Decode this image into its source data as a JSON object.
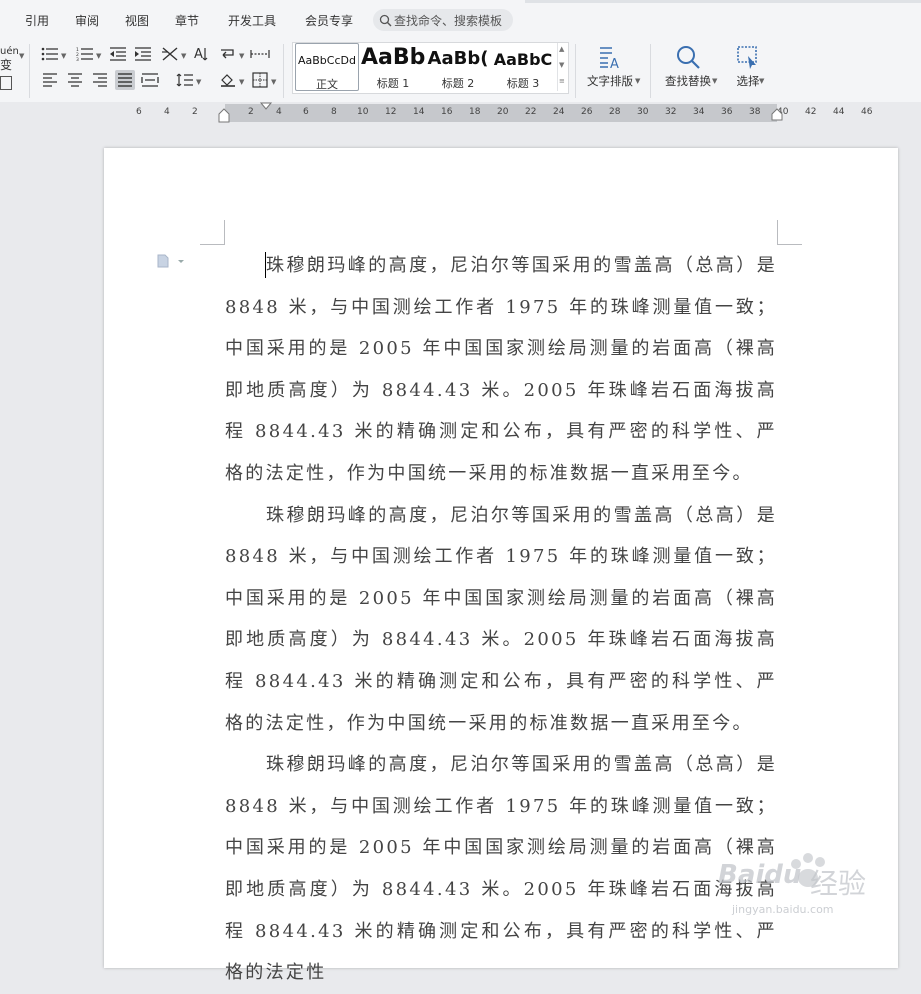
{
  "menu": {
    "items": [
      "引用",
      "审阅",
      "视图",
      "章节",
      "开发工具",
      "会员专享"
    ],
    "search_placeholder": "查找命令、搜索模板"
  },
  "ribbon": {
    "partial_left_glyphs": [
      "uén",
      "变"
    ],
    "styles": [
      {
        "sample": "AaBbCcDd",
        "name": "正文"
      },
      {
        "sample": "AaBb",
        "name": "标题 1"
      },
      {
        "sample": "AaBb(",
        "name": "标题 2"
      },
      {
        "sample": "AaBbC",
        "name": "标题 3"
      }
    ],
    "text_layout_label": "文字排版",
    "find_replace_label": "查找替换",
    "select_label": "选择"
  },
  "ruler": {
    "numbers": [
      "6",
      "4",
      "2",
      "2",
      "4",
      "6",
      "8",
      "10",
      "12",
      "14",
      "16",
      "18",
      "20",
      "22",
      "24",
      "26",
      "28",
      "30",
      "32",
      "34",
      "36",
      "38",
      "40",
      "42",
      "44",
      "46"
    ]
  },
  "document": {
    "paragraphs": [
      "珠穆朗玛峰的高度，尼泊尔等国采用的雪盖高（总高）是 8848 米，与中国测绘工作者 1975 年的珠峰测量值一致；中国采用的是 2005 年中国国家测绘局测量的岩面高（裸高即地质高度）为 8844.43 米。2005 年珠峰岩石面海拔高程 8844.43 米的精确测定和公布，具有严密的科学性、严格的法定性，作为中国统一采用的标准数据一直采用至今。",
      "珠穆朗玛峰的高度，尼泊尔等国采用的雪盖高（总高）是 8848 米，与中国测绘工作者 1975 年的珠峰测量值一致；中国采用的是 2005 年中国国家测绘局测量的岩面高（裸高即地质高度）为 8844.43 米。2005 年珠峰岩石面海拔高程 8844.43 米的精确测定和公布，具有严密的科学性、严格的法定性，作为中国统一采用的标准数据一直采用至今。",
      "珠穆朗玛峰的高度，尼泊尔等国采用的雪盖高（总高）是 8848 米，与中国测绘工作者 1975 年的珠峰测量值一致；中国采用的是 2005 年中国国家测绘局测量的岩面高（裸高即地质高度）为 8844.43 米。2005 年珠峰岩石面海拔高程 8844.43 米的精确测定和公布，具有严密的科学性、严格的法定性"
    ]
  },
  "watermark": {
    "brand": "Baidu",
    "cn": "经验",
    "url": "jingyan.baidu.com"
  }
}
